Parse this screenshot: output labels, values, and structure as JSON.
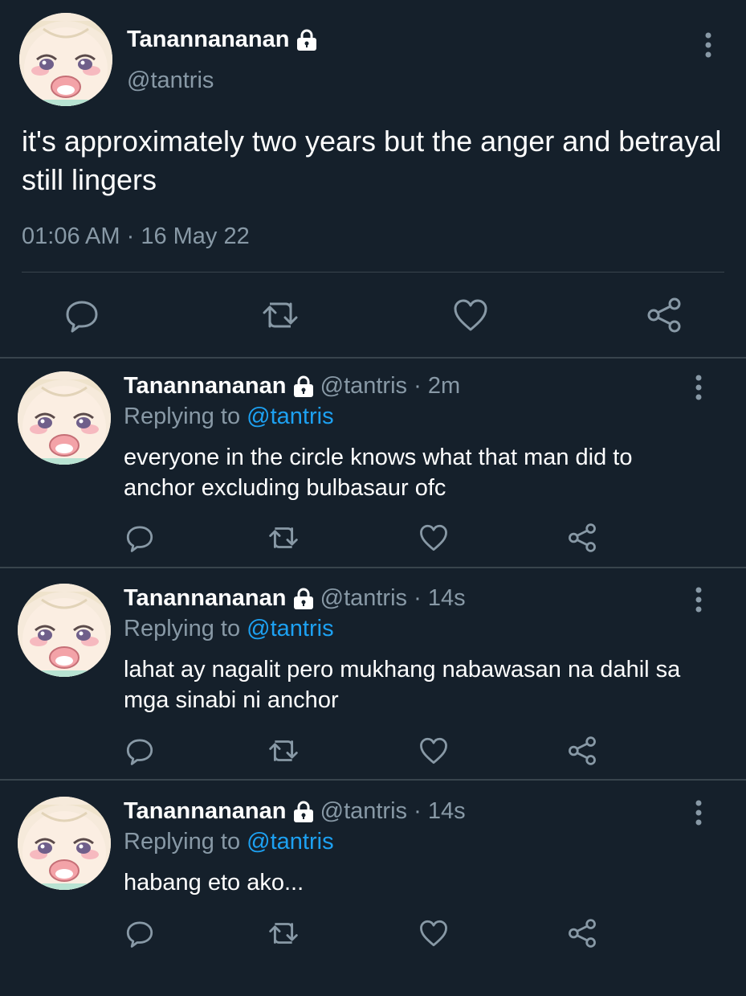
{
  "colors": {
    "background": "#15202b",
    "text_primary": "#ffffff",
    "text_secondary": "#8899a6",
    "link": "#1da1f2",
    "divider": "#38444d"
  },
  "main_tweet": {
    "display_name": "Tanannananan",
    "handle": "@tantris",
    "text": "it's approximately two years but the anger and betrayal still lingers",
    "time": "01:06 AM",
    "date_separator": "·",
    "date": "16 May 22",
    "icons": {
      "more": "more-vertical-icon",
      "reply": "reply-icon",
      "retweet": "retweet-icon",
      "like": "heart-icon",
      "share": "share-icon",
      "protected": "lock-icon"
    }
  },
  "replies": [
    {
      "display_name": "Tanannananan",
      "handle": "@tantris",
      "separator": "·",
      "time": "2m",
      "replying_to_label": "Replying to",
      "replying_to_handle": "@tantris",
      "text": "everyone in the circle knows what that man did to anchor excluding bulbasaur ofc"
    },
    {
      "display_name": "Tanannananan",
      "handle": "@tantris",
      "separator": "·",
      "time": "14s",
      "replying_to_label": "Replying to",
      "replying_to_handle": "@tantris",
      "text": "lahat ay nagalit pero mukhang nabawasan na dahil sa mga sinabi ni anchor"
    },
    {
      "display_name": "Tanannananan",
      "handle": "@tantris",
      "separator": "·",
      "time": "14s",
      "replying_to_label": "Replying to",
      "replying_to_handle": "@tantris",
      "text": "habang eto ako..."
    }
  ]
}
